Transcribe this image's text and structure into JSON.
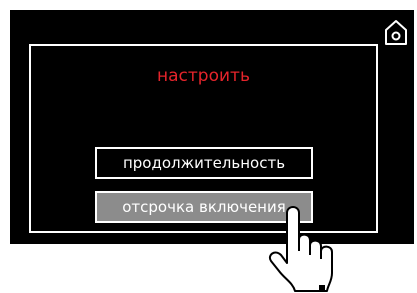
{
  "colors": {
    "screen_bg": "#000000",
    "title_color": "#e5242b",
    "text_color": "#ffffff",
    "selected_option_bg": "#8c8c8c"
  },
  "screen": {
    "home_icon": "home-icon",
    "title": "настроить",
    "options": [
      {
        "label": "продолжительность",
        "selected": false
      },
      {
        "label": "отсрочка включения",
        "selected": true
      }
    ]
  },
  "pointer": {
    "icon": "pointing-hand-icon"
  }
}
